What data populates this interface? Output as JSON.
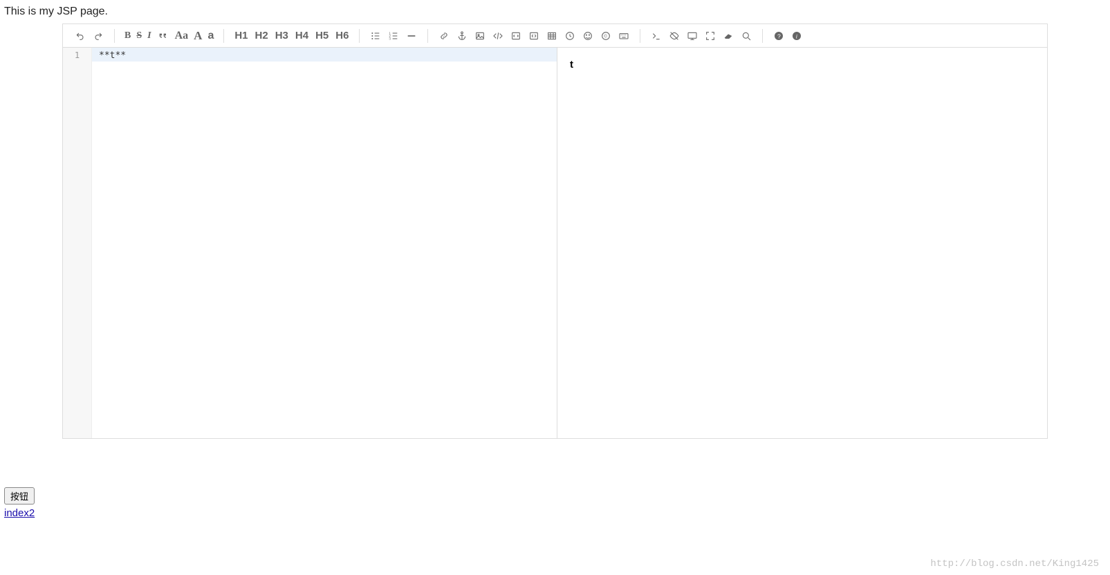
{
  "page_title": "This is my JSP page.",
  "toolbar": {
    "undo": "undo",
    "redo": "redo",
    "bold": "B",
    "strike": "S",
    "italic": "I",
    "quote": "quote",
    "uppercase": "Aa",
    "font_a_serif": "A",
    "font_a_sans": "a",
    "h1": "H1",
    "h2": "H2",
    "h3": "H3",
    "h4": "H4",
    "h5": "H5",
    "h6": "H6",
    "ul": "ul",
    "ol": "ol",
    "hr": "hr",
    "link": "link",
    "anchor": "anchor",
    "image": "image",
    "code": "code",
    "code_block": "code-block",
    "preformatted": "preformatted",
    "table": "table",
    "datetime": "datetime",
    "emoji": "emoji",
    "special": "special",
    "keyboard": "keyboard",
    "goto": "goto",
    "watch": "watch",
    "preview": "preview",
    "fullscreen": "fullscreen",
    "clear": "clear",
    "search": "search",
    "help": "help",
    "info": "info"
  },
  "editor": {
    "line_number": "1",
    "source_content": "**t**",
    "preview_content": "t"
  },
  "button_label": "按钮",
  "link_label": "index2",
  "watermark": "http://blog.csdn.net/King1425"
}
